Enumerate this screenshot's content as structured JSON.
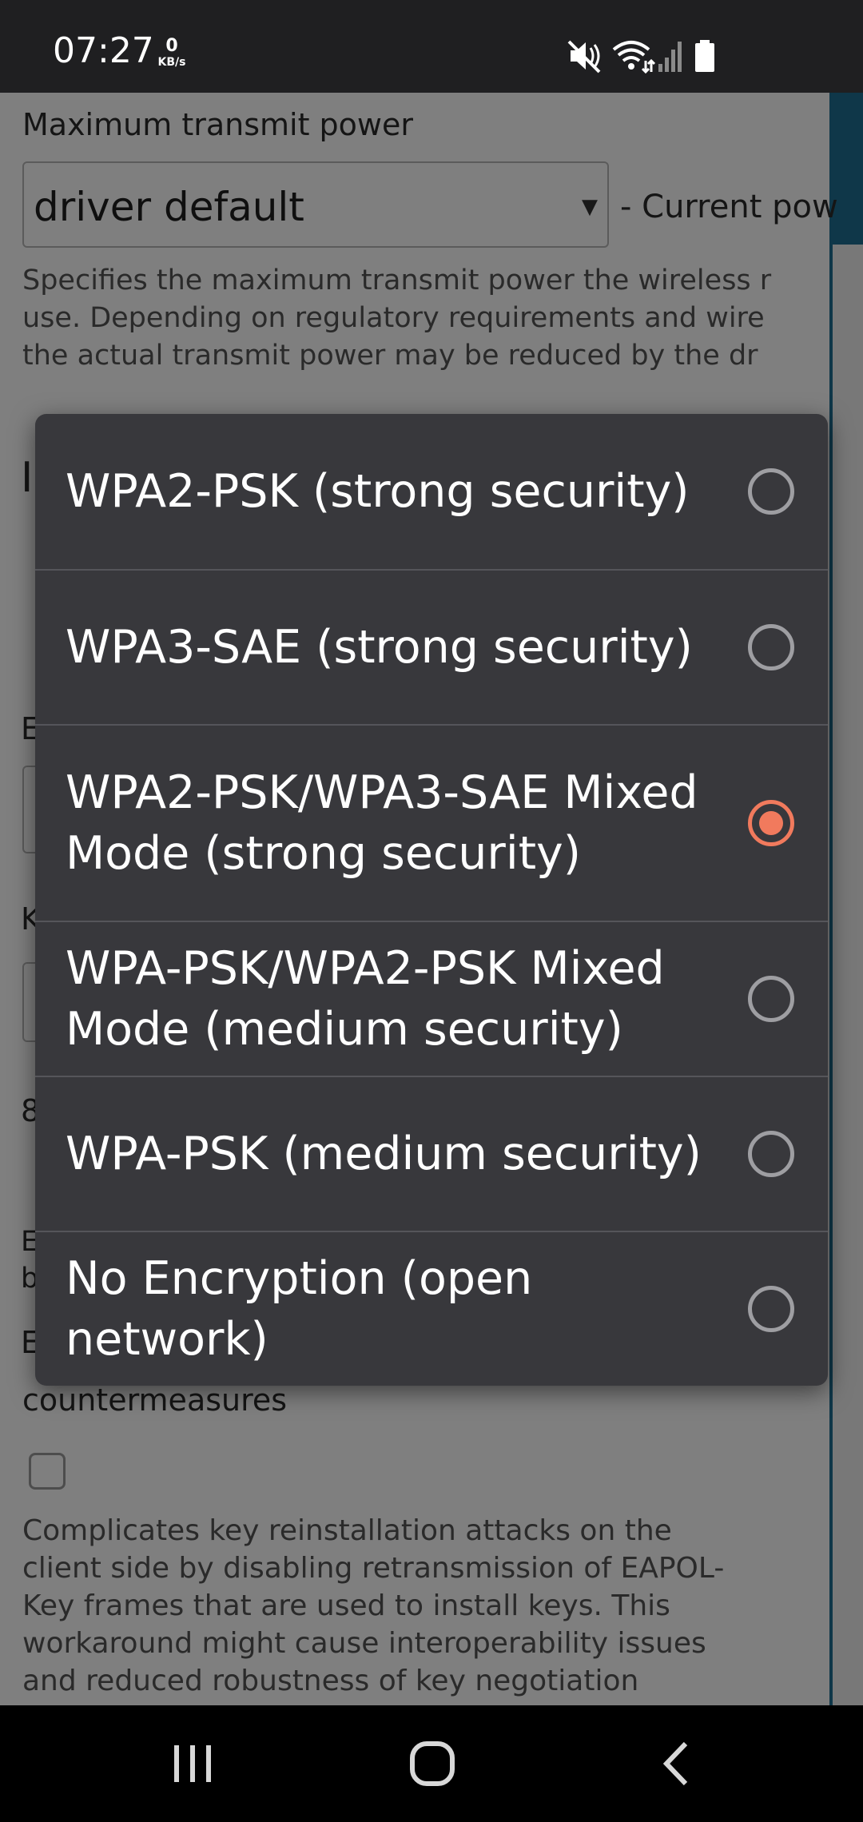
{
  "status_bar": {
    "time": "07:27",
    "net_speed_value": "0",
    "net_speed_unit": "KB/s",
    "icons": [
      "mute-icon",
      "wifi-icon",
      "signal-icon",
      "battery-icon"
    ]
  },
  "page": {
    "tx_power_label": "Maximum transmit power",
    "tx_power_value": "driver default",
    "tx_power_suffix": "- Current pow",
    "tx_power_desc": "Specifies the maximum transmit power the wireless r\nuse. Depending on regulatory requirements and wire\nthe actual transmit power may be reduced by the dr",
    "left_fragments": [
      "I",
      "E",
      "K",
      "8",
      "E",
      "b"
    ],
    "countermeasures_label": "countermeasures",
    "countermeasures_partial": "E",
    "countermeasures_desc": "Complicates key reinstallation attacks on the\nclient side by disabling retransmission of EAPOL-\nKey frames that are used to install keys. This\nworkaround might cause interoperability issues\nand reduced robustness of key negotiation"
  },
  "dialog": {
    "options": [
      {
        "label": "WPA2-PSK (strong security)",
        "selected": false
      },
      {
        "label": "WPA3-SAE (strong security)",
        "selected": false
      },
      {
        "label": "WPA2-PSK/WPA3-SAE Mixed Mode (strong security)",
        "selected": true
      },
      {
        "label": "WPA-PSK/WPA2-PSK Mixed Mode (medium security)",
        "selected": false
      },
      {
        "label": "WPA-PSK (medium security)",
        "selected": false
      },
      {
        "label": "No Encryption (open network)",
        "selected": false
      }
    ]
  },
  "nav_bar": {
    "buttons": [
      "recent-apps-icon",
      "home-icon",
      "back-icon"
    ]
  },
  "colors": {
    "dialog_bg": "#38383c",
    "accent": "#f17a5d",
    "divider": "#55555a",
    "radio_off": "#9e9ea2"
  }
}
